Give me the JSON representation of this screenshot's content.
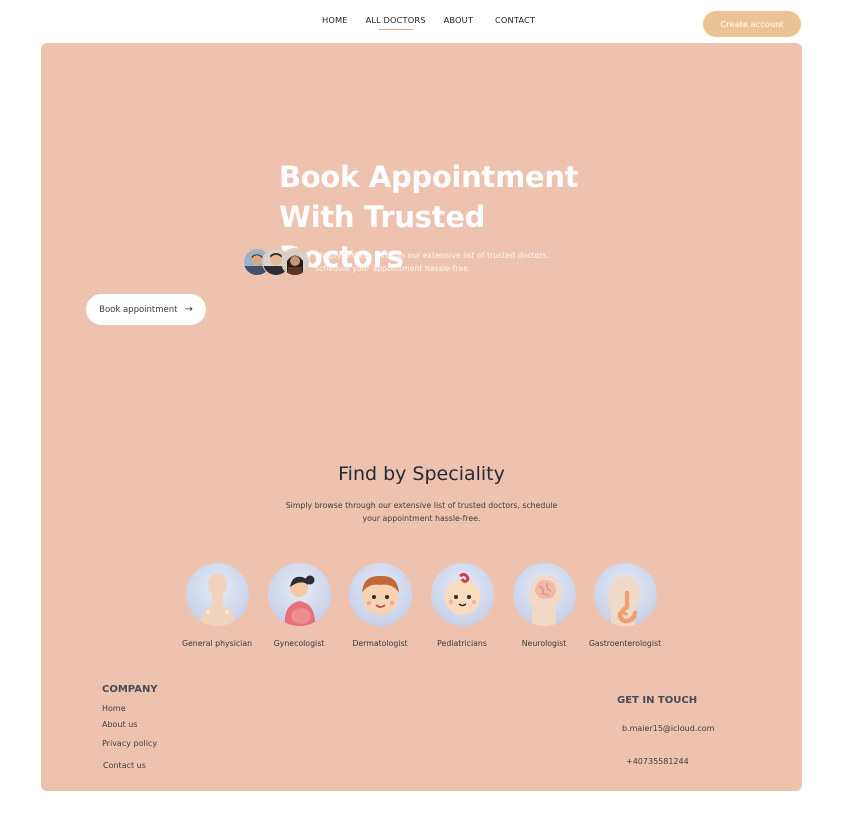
{
  "nav": {
    "links": [
      {
        "label": "HOME"
      },
      {
        "label": "ALL DOCTORS"
      },
      {
        "label": "ABOUT"
      },
      {
        "label": "CONTACT"
      }
    ],
    "create_account": "Create account"
  },
  "hero": {
    "title_line1": "Book Appointment",
    "title_line2": "With Trusted Doctors",
    "description_line1": "Simply browse through our extensive list of trusted doctors,",
    "description_line2": "schedule your appointment hassle-free.",
    "book_button": "Book appointment",
    "arrow_icon": "arrow-right-icon"
  },
  "speciality": {
    "title": "Find by Speciality",
    "description_line1": "Simply browse through our extensive list of trusted doctors, schedule",
    "description_line2": "your appointment hassle-free.",
    "items": [
      {
        "label": "General physician",
        "icon": "general-physician-icon"
      },
      {
        "label": "Gynecologist",
        "icon": "gynecologist-icon"
      },
      {
        "label": "Dermatologist",
        "icon": "dermatologist-icon"
      },
      {
        "label": "Pediatricians",
        "icon": "pediatricians-icon"
      },
      {
        "label": "Neurologist",
        "icon": "neurologist-icon"
      },
      {
        "label": "Gastroenterologist",
        "icon": "gastroenterologist-icon"
      }
    ]
  },
  "footer": {
    "company_heading": "COMPANY",
    "company_links": [
      {
        "label": "Home"
      },
      {
        "label": "About us"
      },
      {
        "label": "Privacy policy"
      },
      {
        "label": "Contact us"
      }
    ],
    "contact_heading": "GET IN TOUCH",
    "email": "b.maier15@icloud.com",
    "phone": "+40735581244"
  },
  "colors": {
    "panel": "#edc2ae",
    "accent_button": "#edc393",
    "nav_underline": "#f0a070",
    "specialty_circle": "#c9d2ea"
  }
}
